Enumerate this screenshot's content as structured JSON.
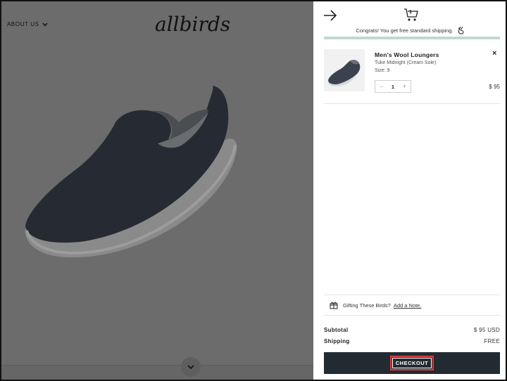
{
  "header": {
    "about_label": "ABOUT US",
    "logo_text": "allbirds"
  },
  "cart": {
    "item_count": "1",
    "shipping_message": "Congrats! You get free standard shipping.",
    "shipping_progress": 1.0,
    "items": [
      {
        "name": "Men's Wool Loungers",
        "variant": "Tuke Midnight (Cream Sole)",
        "size": "Size: 9",
        "quantity": "1",
        "price": "$ 95",
        "remove_label": "×",
        "minus_label": "−",
        "plus_label": "+"
      }
    ],
    "gift": {
      "label": "Gifting These Birds?",
      "link": "Add a Note."
    },
    "subtotal_label": "Subtotal",
    "subtotal_value": "$ 95 USD",
    "shipping_label": "Shipping",
    "shipping_value": "FREE",
    "checkout_label": "CHECKOUT"
  },
  "colors": {
    "overlay": "#6c6c6c",
    "checkout_bg": "#222b31",
    "progress": "#c3d6d3",
    "highlight": "#e03a3a"
  }
}
